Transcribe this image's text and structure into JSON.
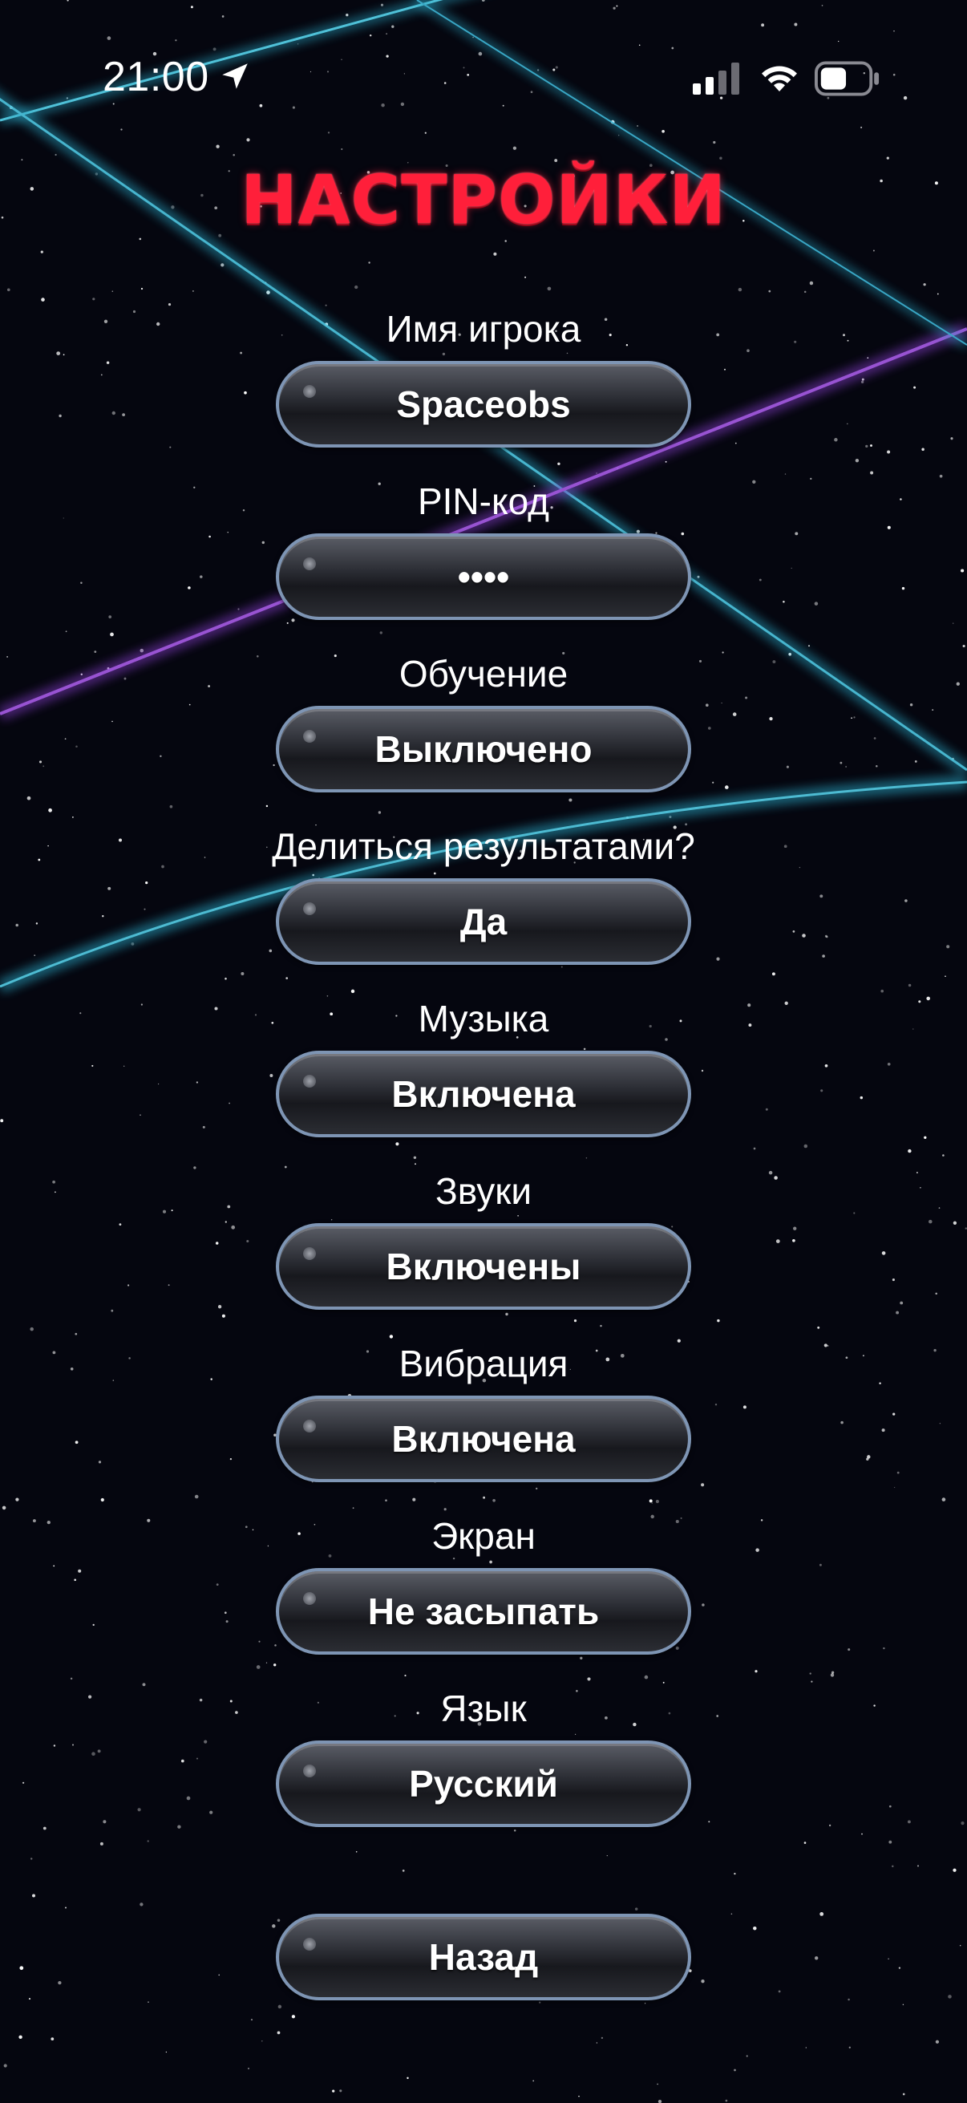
{
  "status_bar": {
    "time": "21:00"
  },
  "title": "НАСТРОЙКИ",
  "settings": [
    {
      "label": "Имя игрока",
      "value": "Spaceobs"
    },
    {
      "label": "PIN-код",
      "value": "••••"
    },
    {
      "label": "Обучение",
      "value": "Выключено"
    },
    {
      "label": "Делиться результатами?",
      "value": "Да"
    },
    {
      "label": "Музыка",
      "value": "Включена"
    },
    {
      "label": "Звуки",
      "value": "Включены"
    },
    {
      "label": "Вибрация",
      "value": "Включена"
    },
    {
      "label": "Экран",
      "value": "Не засыпать"
    },
    {
      "label": "Язык",
      "value": "Русский"
    }
  ],
  "back_button": "Назад",
  "colors": {
    "title": "#ff1f3a",
    "laser_cyan": "#2fb8d8",
    "laser_purple": "#8a3fd0",
    "button_border": "#7e95b4"
  }
}
